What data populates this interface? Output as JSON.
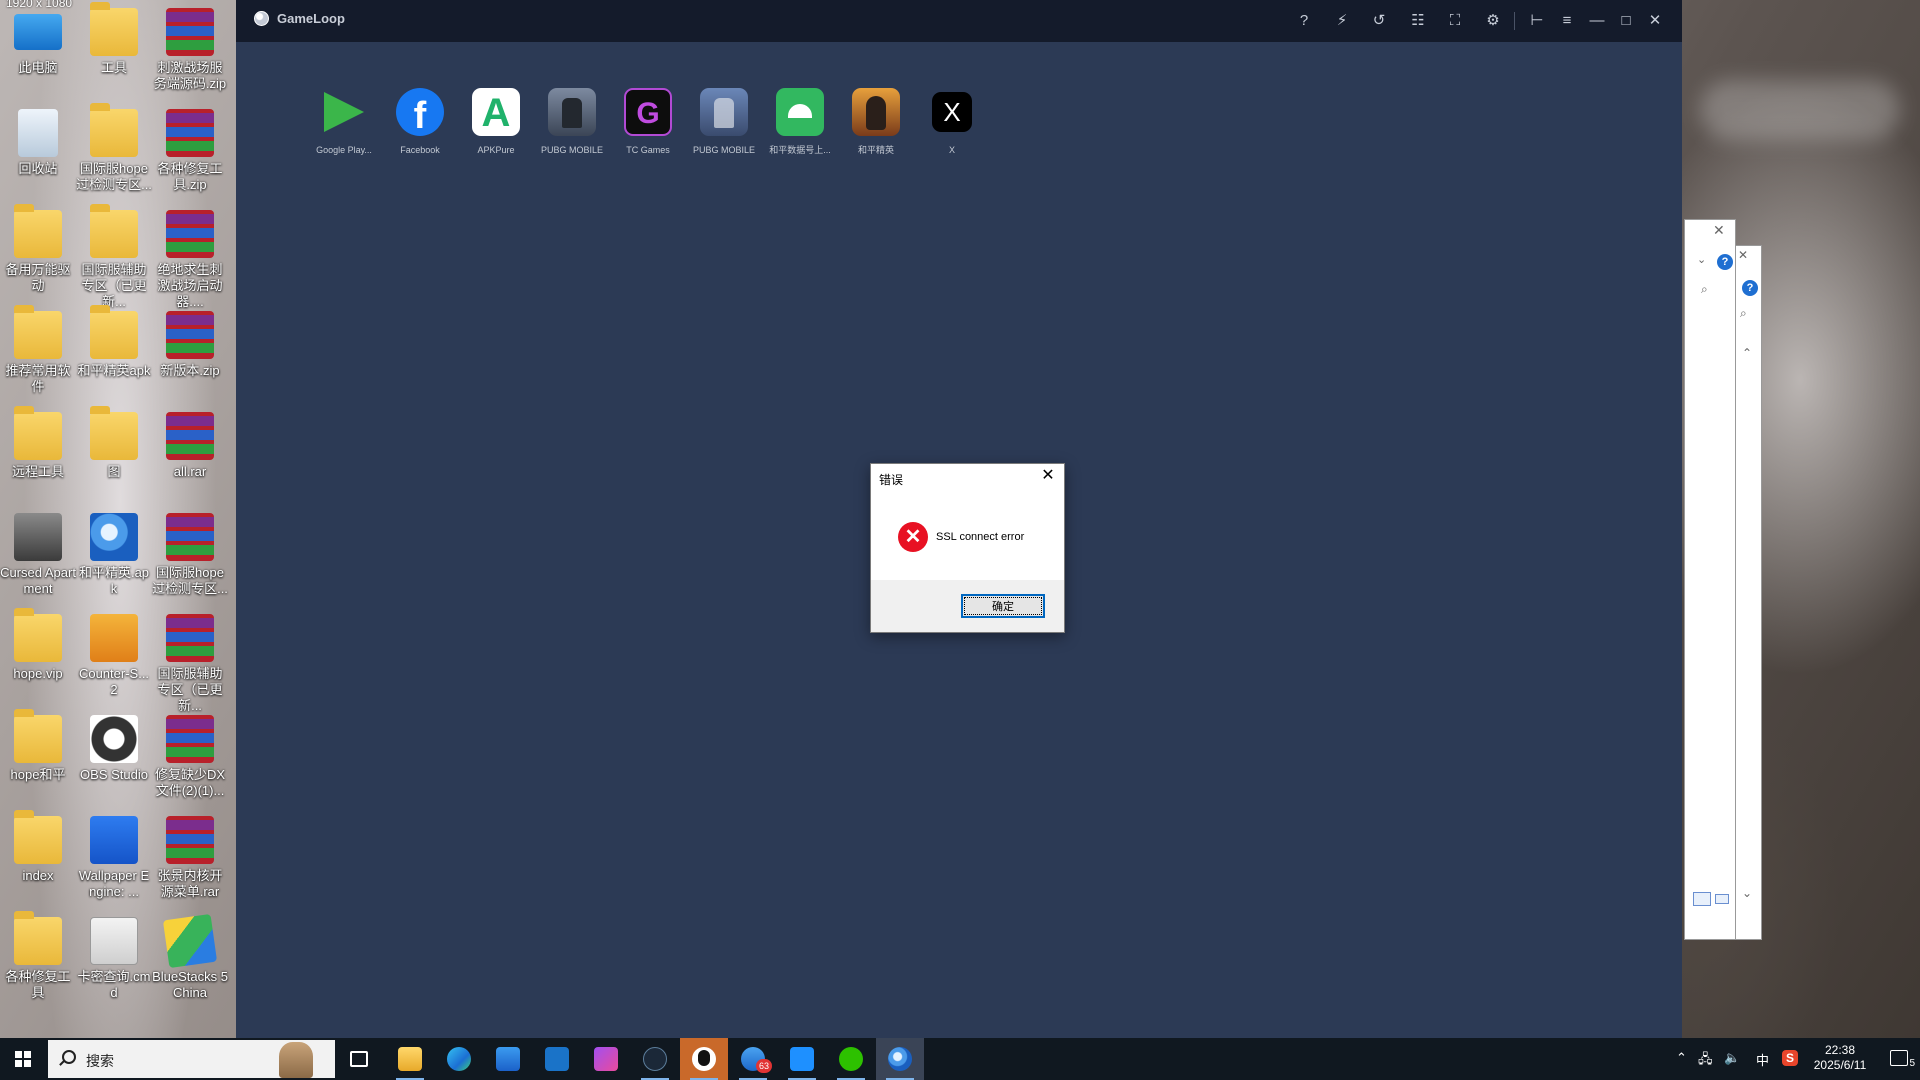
{
  "screen": {
    "resolution_label": "1920 x 1080"
  },
  "desktop": {
    "icons": [
      {
        "label": "此电脑",
        "icon": "computer-icon"
      },
      {
        "label": "工具",
        "icon": "folder-icon"
      },
      {
        "label": "刺激战场服务端源码.zip",
        "icon": "winrar-archive-icon"
      },
      {
        "label": "回收站",
        "icon": "recycle-bin-icon"
      },
      {
        "label": "国际服hope过检测专区...",
        "icon": "folder-icon"
      },
      {
        "label": "各种修复工具.zip",
        "icon": "winrar-archive-icon"
      },
      {
        "label": "备用万能驱动",
        "icon": "folder-icon"
      },
      {
        "label": "国际服辅助专区（已更新...",
        "icon": "folder-icon"
      },
      {
        "label": "绝地求生刺激战场启动器....",
        "icon": "winrar-archive-icon"
      },
      {
        "label": "推荐常用软件",
        "icon": "folder-icon"
      },
      {
        "label": "和平精英apk",
        "icon": "folder-icon"
      },
      {
        "label": "新版本.zip",
        "icon": "winrar-archive-icon"
      },
      {
        "label": "远程工具",
        "icon": "folder-icon"
      },
      {
        "label": "图",
        "icon": "folder-icon"
      },
      {
        "label": "all.rar",
        "icon": "winrar-archive-icon"
      },
      {
        "label": "Cursed Apartment",
        "icon": "game-icon"
      },
      {
        "label": "和平精英.apk",
        "icon": "gameloop-apk-icon"
      },
      {
        "label": "国际服hope过检测专区...",
        "icon": "winrar-archive-icon"
      },
      {
        "label": "hope.vip",
        "icon": "folder-icon"
      },
      {
        "label": "Counter-S... 2",
        "icon": "counter-strike-icon"
      },
      {
        "label": "国际服辅助专区（已更新...",
        "icon": "winrar-archive-icon"
      },
      {
        "label": "hope和平",
        "icon": "folder-icon"
      },
      {
        "label": "OBS Studio",
        "icon": "obs-icon"
      },
      {
        "label": "修复缺少DX文件(2)(1)...",
        "icon": "winrar-archive-icon"
      },
      {
        "label": "index",
        "icon": "folder-icon"
      },
      {
        "label": "Wallpaper Engine: ...",
        "icon": "wallpaper-engine-icon"
      },
      {
        "label": "张景内核开源菜单.rar",
        "icon": "winrar-archive-icon"
      },
      {
        "label": "各种修复工具",
        "icon": "folder-icon"
      },
      {
        "label": "卡密查询.cmd",
        "icon": "cmd-file-icon"
      },
      {
        "label": "BlueStacks 5 China",
        "icon": "bluestacks-icon"
      }
    ]
  },
  "gameloop": {
    "title": "GameLoop",
    "controls": [
      {
        "name": "help-icon",
        "glyph": "?"
      },
      {
        "name": "boost-icon",
        "glyph": "⚡"
      },
      {
        "name": "refresh-icon",
        "glyph": "↺"
      },
      {
        "name": "apps-grid-icon",
        "glyph": "☷"
      },
      {
        "name": "fullscreen-icon",
        "glyph": "⛶"
      },
      {
        "name": "settings-icon",
        "glyph": "⚙"
      },
      {
        "name": "pin-icon",
        "glyph": "⊢"
      },
      {
        "name": "menu-icon",
        "glyph": "≡"
      },
      {
        "name": "minimize-icon",
        "glyph": "—"
      },
      {
        "name": "maximize-icon",
        "glyph": "□"
      },
      {
        "name": "close-icon",
        "glyph": "✕"
      }
    ],
    "apps": [
      {
        "label": "Google Play...",
        "icon": "google-play-games-icon",
        "glyph": ""
      },
      {
        "label": "Facebook",
        "icon": "facebook-icon",
        "glyph": "f"
      },
      {
        "label": "APKPure",
        "icon": "apkpure-icon",
        "glyph": "A"
      },
      {
        "label": "PUBG MOBILE",
        "icon": "pubg-mobile-icon",
        "glyph": ""
      },
      {
        "label": "TC Games",
        "icon": "tc-games-icon",
        "glyph": "G"
      },
      {
        "label": "PUBG MOBILE",
        "icon": "pubg-mobile-icon",
        "glyph": ""
      },
      {
        "label": "和平数据号上...",
        "icon": "android-app-icon",
        "glyph": ""
      },
      {
        "label": "和平精英",
        "icon": "peace-elite-icon",
        "glyph": ""
      },
      {
        "label": "X",
        "icon": "x-icon",
        "glyph": "X"
      }
    ]
  },
  "error_dialog": {
    "title": "错误",
    "message": "SSL connect error",
    "ok_label": "确定",
    "close_glyph": "✕",
    "error_glyph": "✕"
  },
  "taskbar": {
    "search_placeholder": "搜索",
    "ime": "中",
    "sogou": "S",
    "time": "22:38",
    "date": "2025/6/11",
    "mail_badge": "63",
    "notification_count": "5"
  }
}
